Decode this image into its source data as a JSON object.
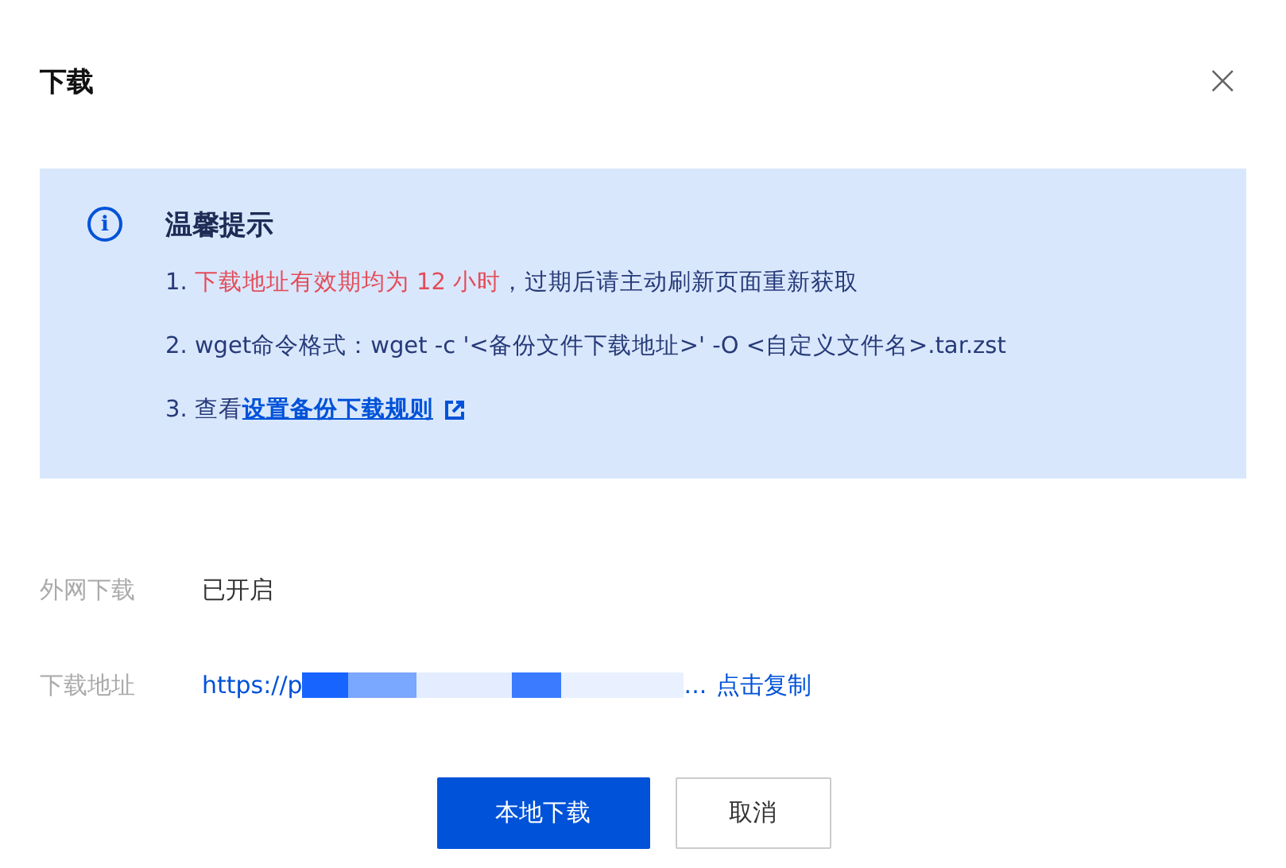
{
  "dialog": {
    "title": "下载",
    "close": "×"
  },
  "notice": {
    "icon": "i",
    "title": "温馨提示",
    "items": [
      {
        "parts": [
          {
            "kind": "plain",
            "text": "1. "
          },
          {
            "kind": "warning",
            "text": "下载地址有效期均为 12 小时"
          },
          {
            "kind": "plain",
            "text": "，过期后请主动刷新页面重新获取"
          }
        ]
      },
      {
        "parts": [
          {
            "kind": "plain",
            "text": "2. wget命令格式：wget -c '<备份文件下载地址>' -O <自定义文件名>.tar.zst"
          }
        ]
      },
      {
        "parts": [
          {
            "kind": "plain",
            "text": "3. 查看"
          },
          {
            "kind": "link",
            "text": "设置备份下载规则"
          }
        ]
      }
    ]
  },
  "fields": [
    {
      "kind": "text",
      "label": "外网下载",
      "value": "已开启"
    },
    {
      "kind": "url",
      "label": "下载地址",
      "value": "https://p",
      "suffix": "...",
      "action": "点击复制"
    }
  ],
  "buttons": [
    {
      "kind": "primary",
      "label": "本地下载"
    },
    {
      "kind": "secondary",
      "label": "取消"
    }
  ]
}
